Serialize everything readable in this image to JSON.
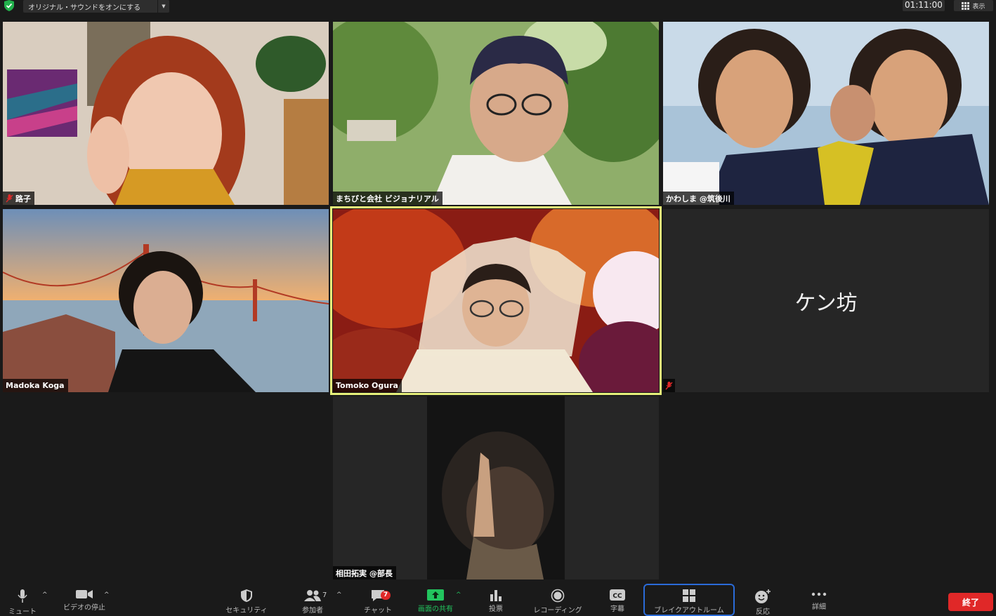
{
  "topbar": {
    "sound_button": "オリジナル・サウンドをオンにする",
    "timer": "01:11:00",
    "view_label": "表示"
  },
  "participants": [
    {
      "name": "路子",
      "muted": true
    },
    {
      "name": "まちびと会社 ビジョナリアル",
      "muted": false
    },
    {
      "name": "かわしま @筑後川",
      "muted": false
    },
    {
      "name": "Madoka Koga",
      "muted": false
    },
    {
      "name": "Tomoko Ogura",
      "muted": false,
      "active_speaker": true
    },
    {
      "name": "ケン坊",
      "muted": true,
      "video_off": true
    },
    {
      "name": "相田拓実 @部長",
      "muted": false
    }
  ],
  "toolbar": {
    "mute": "ミュート",
    "video": "ビデオの停止",
    "security": "セキュリティ",
    "participants": "参加者",
    "participants_count": "7",
    "chat": "チャット",
    "chat_badge": "7",
    "share": "画面の共有",
    "polls": "投票",
    "record": "レコーディング",
    "captions": "字幕",
    "breakout": "ブレイクアウトルーム",
    "reactions": "反応",
    "more": "詳細",
    "end": "終了"
  },
  "colors": {
    "active_speaker_border": "#e6f07a",
    "end_button": "#e02828",
    "share_green": "#22c55e",
    "breakout_highlight": "#2a6bd8",
    "badge_red": "#e02828"
  }
}
